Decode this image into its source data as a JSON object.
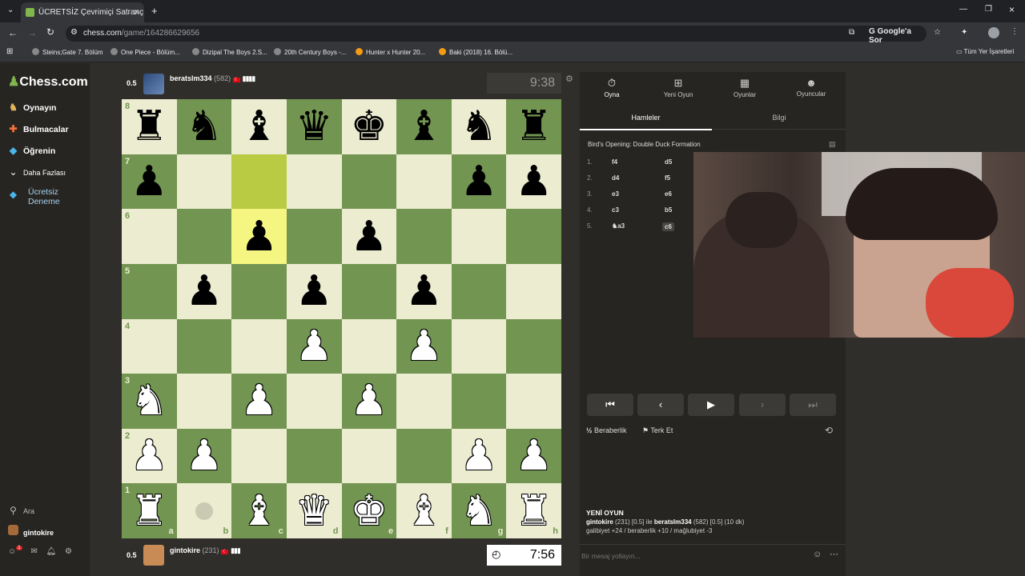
{
  "browser": {
    "tab_title": "ÜCRETSİZ Çevrimiçi Satranç Oy",
    "url_domain": "chess.com",
    "url_path": "/game/164286629656",
    "google_btn": "Google'a Sor",
    "bookmarks": [
      "Steins;Gate 7. Bölüm",
      "One Piece - Bölüm...",
      "Dizipal The Boys 2.S...",
      "20th Century Boys -...",
      "Hunter x Hunter 20...",
      "Baki (2018) 16. Bölü..."
    ],
    "all_bookmarks": "Tüm Yer İşaretleri"
  },
  "sidebar": {
    "logo": "Chess.com",
    "items": [
      {
        "label": "Oynayın",
        "icon": "play-icon"
      },
      {
        "label": "Bulmacalar",
        "icon": "puzzle-icon"
      },
      {
        "label": "Öğrenin",
        "icon": "learn-icon"
      },
      {
        "label": "Daha Fazlası",
        "icon": "chevron-icon"
      },
      {
        "label": "Ücretsiz Deneme",
        "icon": "diamond-icon"
      }
    ],
    "search": "Ara",
    "username": "gintokire",
    "notif_badge": "1"
  },
  "game": {
    "top_player": {
      "name": "beratslm334",
      "rating": "(582)",
      "score": "0.5",
      "clock": "9:38"
    },
    "bottom_player": {
      "name": "gintokire",
      "rating": "(231)",
      "score": "0.5",
      "clock": "7:56"
    },
    "board": [
      [
        "r",
        "n",
        "b",
        "q",
        "k",
        "b",
        "n",
        "r"
      ],
      [
        "p",
        "",
        "",
        "",
        "",
        "",
        "p",
        "p"
      ],
      [
        "",
        "",
        "p",
        "",
        "p",
        "",
        "",
        ""
      ],
      [
        "",
        "p",
        "",
        "p",
        "",
        "p",
        "",
        ""
      ],
      [
        "",
        "",
        "",
        "P",
        "",
        "P",
        "",
        ""
      ],
      [
        "N",
        "",
        "P",
        "",
        "P",
        "",
        "",
        ""
      ],
      [
        "P",
        "P",
        "",
        "",
        "",
        "",
        "P",
        "P"
      ],
      [
        "R",
        "",
        "B",
        "Q",
        "K",
        "B",
        "N",
        "R"
      ]
    ],
    "ranks": [
      "8",
      "7",
      "6",
      "5",
      "4",
      "3",
      "2",
      "1"
    ],
    "files": [
      "a",
      "b",
      "c",
      "d",
      "e",
      "f",
      "g",
      "h"
    ]
  },
  "panel": {
    "tabs": [
      {
        "label": "Oyna",
        "icon": "stopwatch-icon"
      },
      {
        "label": "Yeni Oyun",
        "icon": "plus-icon"
      },
      {
        "label": "Oyunlar",
        "icon": "board-icon"
      },
      {
        "label": "Oyuncular",
        "icon": "players-icon"
      }
    ],
    "subtabs": [
      "Hamleler",
      "Bilgi"
    ],
    "opening": "Bird's Opening: Double Duck Formation",
    "moves": [
      {
        "n": "1.",
        "w": "f4",
        "b": "d5"
      },
      {
        "n": "2.",
        "w": "d4",
        "b": "f5"
      },
      {
        "n": "3.",
        "w": "e3",
        "b": "e6"
      },
      {
        "n": "4.",
        "w": "c3",
        "b": "b5"
      },
      {
        "n": "5.",
        "w": "♞a3",
        "b": "c6"
      }
    ],
    "draw": "Beraberlik",
    "resign": "Terk Et",
    "new_game_title": "YENİ OYUN",
    "new_game_line1_a": "gintokire",
    "new_game_line1_b": " (231) [0.5] ile ",
    "new_game_line1_c": "beratslm334",
    "new_game_line1_d": " (582) [0.5] (10 dk)",
    "new_game_line2": "galibiyet +24 / beraberlik +10 / mağlubiyet -3",
    "chat_placeholder": "Bir mesaj yollayın..."
  }
}
